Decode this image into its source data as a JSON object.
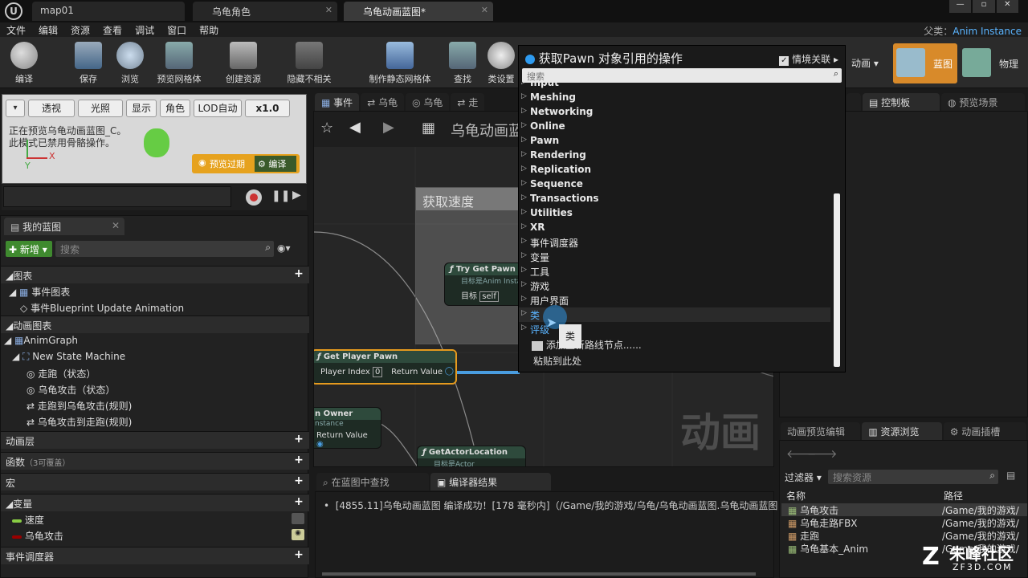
{
  "tabs": [
    {
      "label": "map01"
    },
    {
      "label": "乌龟角色"
    },
    {
      "label": "乌龟动画蓝图*"
    }
  ],
  "menu": [
    "文件",
    "编辑",
    "资源",
    "查看",
    "调试",
    "窗口",
    "帮助"
  ],
  "parent": {
    "label": "父类：",
    "value": "Anim Instance"
  },
  "toolbar": {
    "compile": "编译",
    "save": "保存",
    "browse": "浏览",
    "preview_mesh": "预览网格体",
    "create_asset": "创建资源",
    "hide_unrelated": "隐藏不相关",
    "make_static_mesh": "制作静态网格体",
    "find": "查找",
    "class_settings": "类设置",
    "animation": "动画",
    "blueprint": "蓝图",
    "physics": "物理"
  },
  "viewport": {
    "perspective": "透视",
    "lit": "光照",
    "show": "显示",
    "character": "角色",
    "lod": "LOD自动",
    "scale": "x1.0",
    "info1": "正在预览乌龟动画蓝图_C。",
    "info2": "此模式已禁用骨骼操作。",
    "preview_expired": "预览过期",
    "compile": "编译",
    "axis_x": "X",
    "axis_y": "Y"
  },
  "mybp": {
    "title": "我的蓝图",
    "new": "新增",
    "search_placeholder": "搜索",
    "graphs": "图表",
    "event_graph": "事件图表",
    "event_bp_update": "事件Blueprint Update Animation",
    "anim_graphs": "动画图表",
    "anim_graph": "AnimGraph",
    "state_machine": "New State Machine",
    "run_state": "走跑（状态）",
    "attack_state": "乌龟攻击（状态）",
    "rule1": "走跑到乌龟攻击(规则)",
    "rule2": "乌龟攻击到走跑(规则)",
    "anim_layers": "动画层",
    "functions": "函数",
    "functions_note": "（3可覆盖）",
    "macros": "宏",
    "variables": "变量",
    "var_speed": "速度",
    "var_attack": "乌龟攻击",
    "event_dispatchers": "事件调度器"
  },
  "graph": {
    "tab1": "事件",
    "tab2": "乌龟",
    "tab3": "乌龟",
    "tab4": "走",
    "breadcrumb": "乌龟动画蓝",
    "comment": "获取速度",
    "watermark": "动画",
    "node_try": "Try Get Pawn Ow",
    "node_try_sub": "目标是Anim Insta",
    "pin_target": "目标",
    "pin_self": "self",
    "node_gpp": "Get Player Pawn",
    "pin_player_index": "Player Index",
    "pin_player_index_val": "0",
    "pin_return": "Return Value",
    "node_owner": "n Owner",
    "node_owner_sub": "nstance",
    "node_loc": "GetActorLocation",
    "node_loc_sub": "目标是Actor"
  },
  "action_menu": {
    "title": "获取Pawn 对象引用的操作",
    "context": "情境关联",
    "search_placeholder": "搜索",
    "partial": "Input",
    "items": [
      "Meshing",
      "Networking",
      "Online",
      "Pawn",
      "Rendering",
      "Replication",
      "Sequence",
      "Transactions",
      "Utilities",
      "XR",
      "事件调度器",
      "变量",
      "工具",
      "游戏",
      "用户界面",
      "类",
      "评级"
    ],
    "add_reroute": "添加重新路线节点......",
    "paste": "粘贴到此处",
    "tooltip": "类"
  },
  "right": {
    "control_panel": "控制板",
    "preview_scene": "预览场景",
    "tab_anim_preview": "动画预览编辑",
    "tab_content": "资源浏览",
    "tab_anim_slot": "动画插槽",
    "filter": "过滤器",
    "search_placeholder": "搜索资源",
    "col_name": "名称",
    "col_path": "路径",
    "assets": [
      {
        "name": "乌龟攻击",
        "path": "/Game/我的游戏/"
      },
      {
        "name": "乌龟走路FBX",
        "path": "/Game/我的游戏/"
      },
      {
        "name": "走跑",
        "path": "/Game/我的游戏/"
      },
      {
        "name": "乌龟基本_Anim",
        "path": "/Game/我的游戏/"
      }
    ]
  },
  "bottom": {
    "find_tab": "在蓝图中查找",
    "compiler_tab": "编译器结果",
    "log": "[4855.11]乌龟动画蓝图 编译成功！[178 毫秒内]（/Game/我的游戏/乌龟/乌龟动画蓝图.乌龟动画蓝图"
  },
  "logo": {
    "text1": "朱峰社区",
    "text2": "ZF3D.COM"
  }
}
